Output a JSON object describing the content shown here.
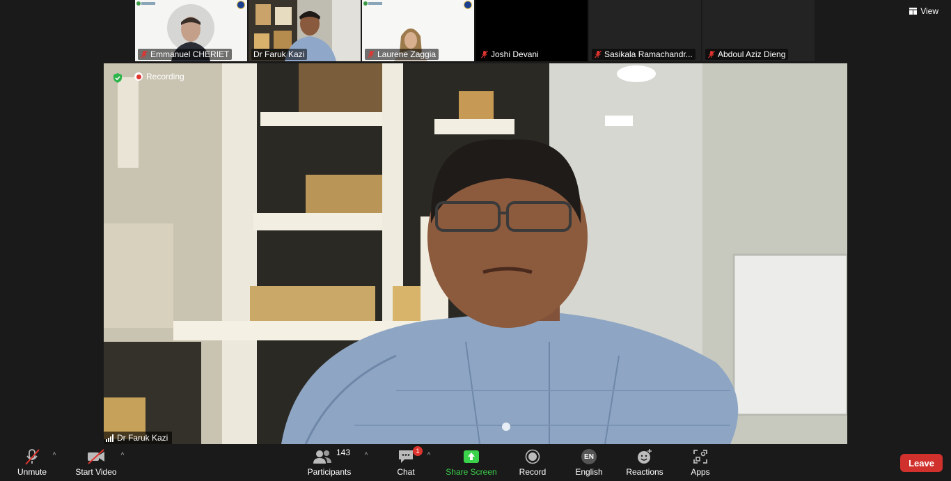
{
  "top": {
    "view_label": "View"
  },
  "gallery": [
    {
      "name": "Emmanuel CHERIET",
      "muted": true,
      "has_video": true,
      "active": false
    },
    {
      "name": "Dr Faruk Kazi",
      "muted": false,
      "has_video": true,
      "active": true
    },
    {
      "name": "Laurene Zaggia",
      "muted": true,
      "has_video": true,
      "active": false
    },
    {
      "name": "Joshi Devani",
      "muted": true,
      "has_video": false,
      "active": false
    },
    {
      "name": "Sasikala Ramachandr...",
      "muted": true,
      "has_video": false,
      "active": false
    },
    {
      "name": "Abdoul Aziz Dieng",
      "muted": true,
      "has_video": false,
      "active": false
    }
  ],
  "stage": {
    "recording_label": "Recording",
    "speaker_name": "Dr Faruk Kazi"
  },
  "toolbar": {
    "unmute": "Unmute",
    "start_video": "Start Video",
    "participants": "Participants",
    "participants_count": "143",
    "chat": "Chat",
    "chat_badge": "1",
    "share_screen": "Share Screen",
    "record": "Record",
    "language": "English",
    "language_code": "EN",
    "reactions": "Reactions",
    "apps": "Apps",
    "leave": "Leave"
  },
  "colors": {
    "background": "#1a1a1a",
    "active_border": "#8bd352",
    "share_green": "#3bd34b",
    "leave_red": "#d0312d",
    "recording_red": "#e0342f",
    "mute_red": "#e0342f"
  }
}
